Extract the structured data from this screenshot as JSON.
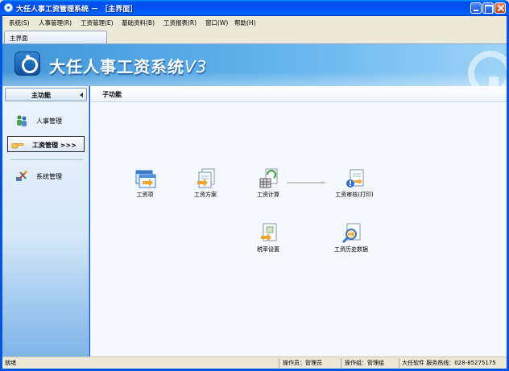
{
  "window": {
    "title": "大任人事工资管理系统 － ［主界面］"
  },
  "menu": {
    "items": [
      "系统(S)",
      "人事管理(R)",
      "工资管理(E)",
      "基础资料(B)",
      "工资报表(R)",
      "窗口(W)",
      "帮助(H)"
    ]
  },
  "tabs": [
    "主界面"
  ],
  "banner": {
    "title": "大任人事工资系统",
    "version": "V3"
  },
  "sidebar": {
    "header": "主功能",
    "items": [
      {
        "label": "人事管理",
        "icon": "people-icon",
        "active": false
      },
      {
        "label": "工资管理 >>>",
        "icon": "hand-pointer-icon",
        "active": true
      },
      {
        "label": "系统管理",
        "icon": "tools-icon",
        "active": false
      }
    ]
  },
  "content": {
    "header": "子功能",
    "functions": [
      {
        "label": "工资项",
        "icon": "windows-icon"
      },
      {
        "label": "工资方案",
        "icon": "document-arrow-icon"
      },
      {
        "label": "工资计算",
        "icon": "calculator-icon"
      },
      {
        "label": "工资审核(打印)",
        "icon": "audit-print-icon"
      },
      {
        "label": "税率设置",
        "icon": "tax-document-icon"
      },
      {
        "label": "工资历史数据",
        "icon": "history-search-icon"
      }
    ]
  },
  "status": {
    "state": "就绪",
    "operator": "操作员：管理员",
    "group": "操作组：管理组",
    "vendor": "大任软件 服务热线：028-85275175"
  }
}
